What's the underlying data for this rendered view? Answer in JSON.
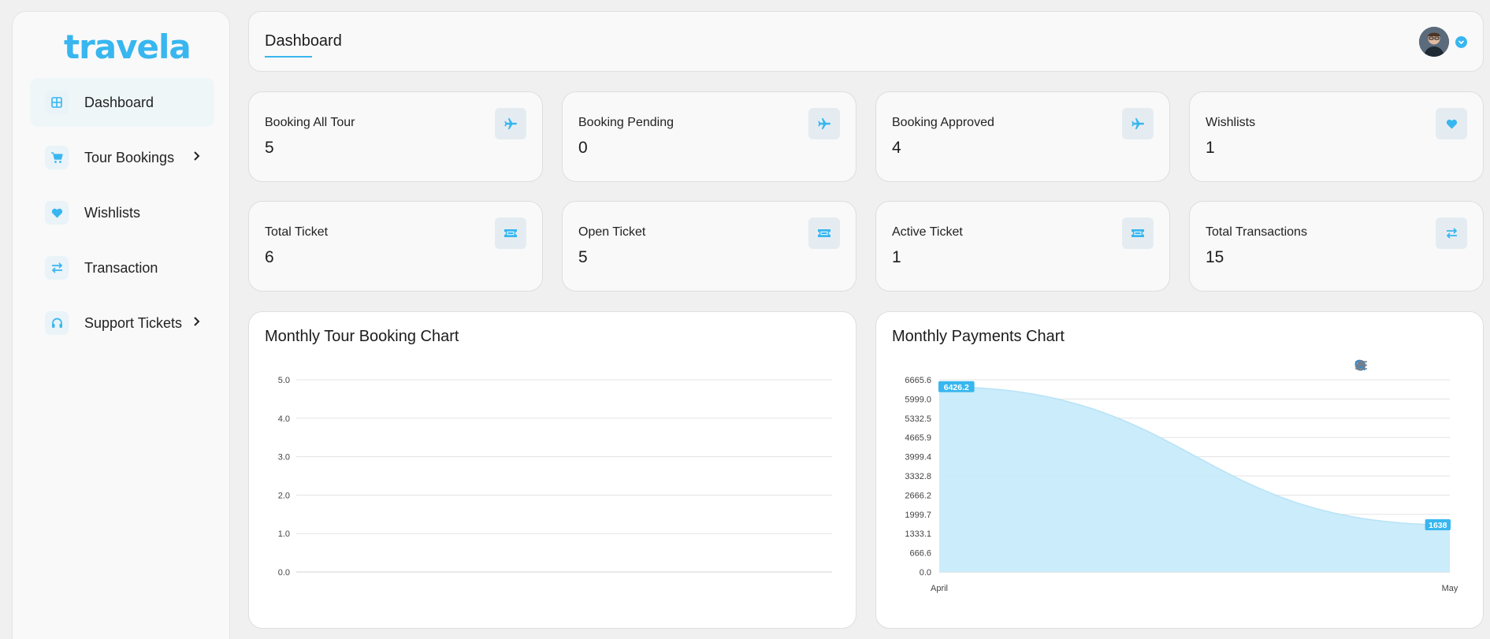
{
  "brand": {
    "logo_text": "travela"
  },
  "sidebar": {
    "items": [
      {
        "label": "Dashboard",
        "icon": "dashboard-grid-icon",
        "active": true,
        "has_submenu": false
      },
      {
        "label": "Tour Bookings",
        "icon": "cart-icon",
        "active": false,
        "has_submenu": true
      },
      {
        "label": "Wishlists",
        "icon": "heart-icon",
        "active": false,
        "has_submenu": false
      },
      {
        "label": "Transaction",
        "icon": "swap-arrows-icon",
        "active": false,
        "has_submenu": false
      },
      {
        "label": "Support Tickets",
        "icon": "headset-icon",
        "active": false,
        "has_submenu": true
      }
    ]
  },
  "header": {
    "title": "Dashboard",
    "avatar": "user-avatar",
    "dropdown_icon": "chevron-down-icon"
  },
  "stats": [
    {
      "label": "Booking All Tour",
      "value": "5",
      "icon": "plane-icon"
    },
    {
      "label": "Booking Pending",
      "value": "0",
      "icon": "plane-icon"
    },
    {
      "label": "Booking Approved",
      "value": "4",
      "icon": "plane-icon"
    },
    {
      "label": "Wishlists",
      "value": "1",
      "icon": "heart-icon"
    },
    {
      "label": "Total Ticket",
      "value": "6",
      "icon": "ticket-icon"
    },
    {
      "label": "Open Ticket",
      "value": "5",
      "icon": "ticket-icon"
    },
    {
      "label": "Active Ticket",
      "value": "1",
      "icon": "ticket-icon"
    },
    {
      "label": "Total Transactions",
      "value": "15",
      "icon": "swap-arrows-icon"
    }
  ],
  "colors": {
    "accent": "#38b6ef",
    "area_fill": "#c8ebfa",
    "grid": "#e3e3e3"
  },
  "chart_data": [
    {
      "type": "line",
      "title": "Monthly Tour Booking Chart",
      "x": [],
      "series": [],
      "yticks": [
        "5.0",
        "4.0",
        "3.0",
        "2.0",
        "1.0",
        "0.0"
      ],
      "ylim": [
        0,
        5
      ],
      "grid": true
    },
    {
      "type": "area",
      "title": "Monthly Payments Chart",
      "x": [
        "April",
        "May"
      ],
      "series": [
        {
          "values": [
            6426.2,
            1638
          ]
        }
      ],
      "data_labels": [
        "6426.2",
        "1638"
      ],
      "yticks": [
        "6665.6",
        "5999.0",
        "5332.5",
        "4665.9",
        "3999.4",
        "3332.8",
        "2666.2",
        "1999.7",
        "1333.1",
        "666.6",
        "0.0"
      ],
      "ylim": [
        0,
        6665.6
      ],
      "grid": true,
      "toolbar": [
        "zoom-in-icon",
        "zoom-out-icon",
        "magnifier-icon",
        "pan-hand-icon",
        "home-icon",
        "menu-icon"
      ]
    }
  ]
}
